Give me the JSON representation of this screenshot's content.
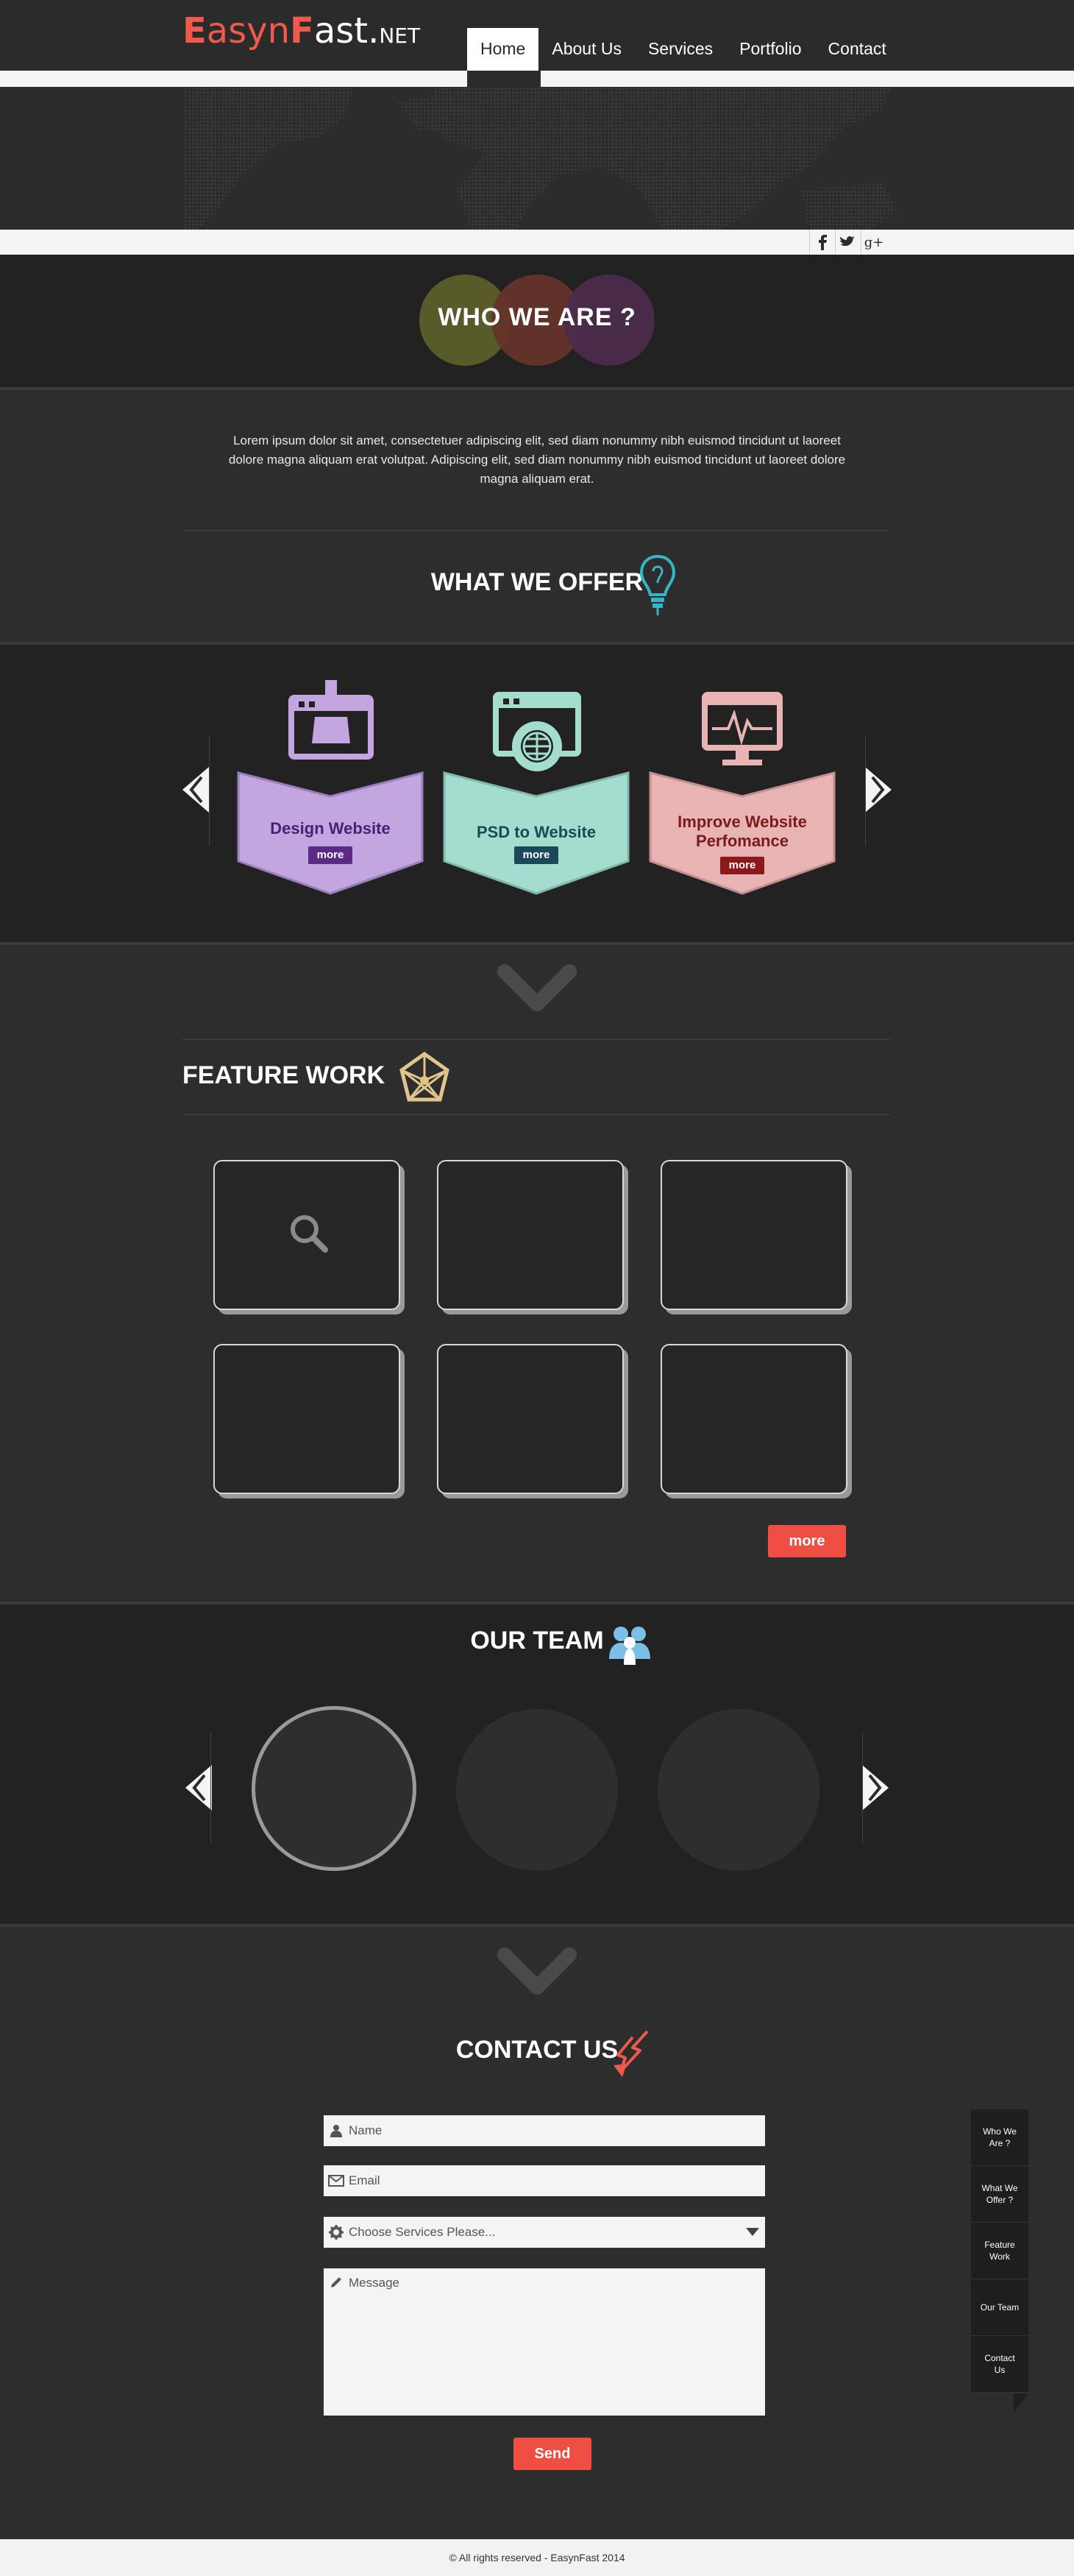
{
  "logo": {
    "part1": "E",
    "part2": "asyn",
    "part3": "F",
    "part4": "ast.",
    "part5": "NET"
  },
  "nav": {
    "items": [
      "Home",
      "About Us",
      "Services",
      "Portfolio",
      "Contact"
    ],
    "active": "Home"
  },
  "social": {
    "icons": [
      "facebook-icon",
      "twitter-icon",
      "google-plus-icon"
    ],
    "labels": [
      "f",
      "t",
      "g+"
    ]
  },
  "who": {
    "title": "WHO WE ARE ?",
    "circle_colors": [
      "#595a2a",
      "#653529",
      "#4a2c4c"
    ],
    "text": "Lorem ipsum dolor sit amet, consectetuer adipiscing elit, sed diam nonummy nibh euismod tincidunt ut laoreet dolore magna aliquam erat volutpat. Adipiscing elit, sed diam nonummy nibh euismod tincidunt ut laoreet dolore magna aliquam erat."
  },
  "offer": {
    "title": "WHAT WE OFFER",
    "items": [
      {
        "label": "Design Website",
        "more": "more",
        "color": "#c3a5e0",
        "text_color": "#4a1f78",
        "badge": "#5a2a86"
      },
      {
        "label": "PSD to Website",
        "more": "more",
        "color": "#a4dccd",
        "text_color": "#1a4a5a",
        "badge": "#1a4a5a"
      },
      {
        "label": "Improve Website Perfomance",
        "more": "more",
        "color": "#e8b3b3",
        "text_color": "#7a1a1a",
        "badge": "#8a1a1a"
      }
    ]
  },
  "feature": {
    "title": "FEATURE WORK",
    "more": "more"
  },
  "team": {
    "title": "OUR TEAM"
  },
  "contact": {
    "title": "CONTACT US",
    "name_placeholder": "Name",
    "email_placeholder": "Email",
    "service_placeholder": "Choose Services Please...",
    "message_placeholder": "Message",
    "send": "Send"
  },
  "sidenav": [
    "Who We Are ?",
    "What We Offer ?",
    "Feature Work",
    "Our Team",
    "Contact Us"
  ],
  "footer": {
    "text": "© All rights reserved - EasynFast 2014"
  },
  "colors": {
    "accent": "#ef4f43",
    "dark": "#222222",
    "light": "#f4f4f4"
  }
}
